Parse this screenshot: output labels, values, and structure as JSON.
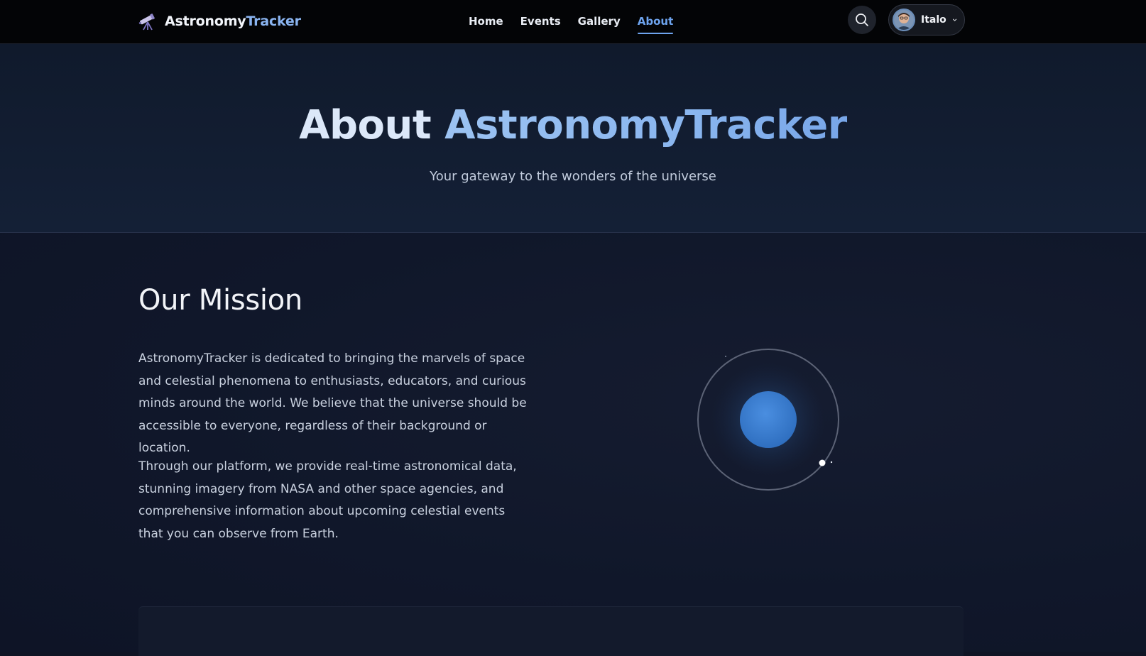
{
  "navbar": {
    "brand_part1": "Astronomy",
    "brand_part2": "Tracker",
    "links": [
      {
        "label": "Home"
      },
      {
        "label": "Events"
      },
      {
        "label": "Gallery"
      },
      {
        "label": "About",
        "active": true
      }
    ],
    "search_icon": "search-icon",
    "user": {
      "name": "Italo",
      "avatar_icon": "avatar",
      "chevron_icon": "chevron-down-icon"
    }
  },
  "hero": {
    "title_part1": "About ",
    "title_part2": "AstronomyTracker",
    "subtitle": "Your gateway to the wonders of the universe"
  },
  "mission": {
    "title": "Our Mission",
    "paragraph1": "AstronomyTracker is dedicated to bringing the marvels of space and celestial phenomena to enthusiasts, educators, and curious minds around the world. We believe that the universe should be accessible to everyone, regardless of their background or location.",
    "paragraph2": "Through our platform, we provide real-time astronomical data, stunning imagery from NASA and other space agencies, and comprehensive information about upcoming celestial events that you can observe from Earth."
  },
  "colors": {
    "accent": "#6ea4ef",
    "planet": "#3a7fd0",
    "background": "#0f1424"
  }
}
